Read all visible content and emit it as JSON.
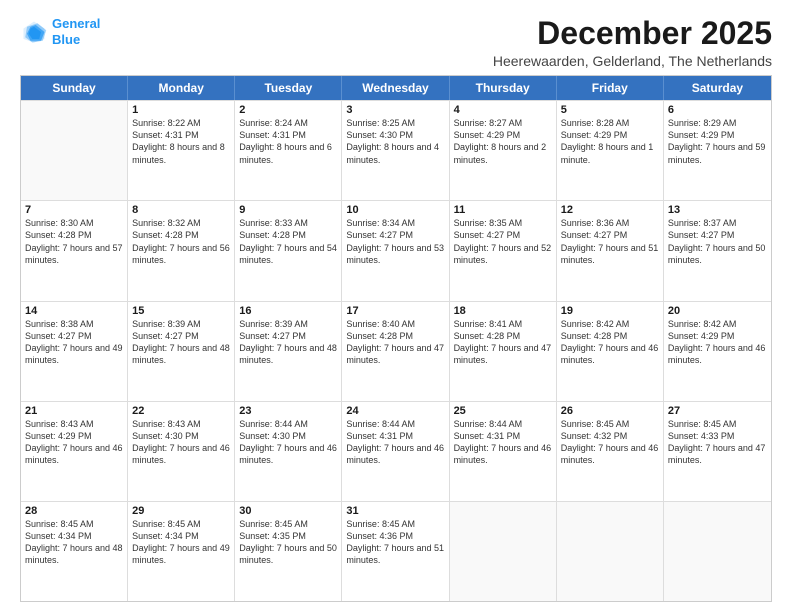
{
  "logo": {
    "line1": "General",
    "line2": "Blue"
  },
  "title": "December 2025",
  "location": "Heerewaarden, Gelderland, The Netherlands",
  "header_days": [
    "Sunday",
    "Monday",
    "Tuesday",
    "Wednesday",
    "Thursday",
    "Friday",
    "Saturday"
  ],
  "weeks": [
    [
      {
        "day": "",
        "sunrise": "",
        "sunset": "",
        "daylight": ""
      },
      {
        "day": "1",
        "sunrise": "Sunrise: 8:22 AM",
        "sunset": "Sunset: 4:31 PM",
        "daylight": "Daylight: 8 hours and 8 minutes."
      },
      {
        "day": "2",
        "sunrise": "Sunrise: 8:24 AM",
        "sunset": "Sunset: 4:31 PM",
        "daylight": "Daylight: 8 hours and 6 minutes."
      },
      {
        "day": "3",
        "sunrise": "Sunrise: 8:25 AM",
        "sunset": "Sunset: 4:30 PM",
        "daylight": "Daylight: 8 hours and 4 minutes."
      },
      {
        "day": "4",
        "sunrise": "Sunrise: 8:27 AM",
        "sunset": "Sunset: 4:29 PM",
        "daylight": "Daylight: 8 hours and 2 minutes."
      },
      {
        "day": "5",
        "sunrise": "Sunrise: 8:28 AM",
        "sunset": "Sunset: 4:29 PM",
        "daylight": "Daylight: 8 hours and 1 minute."
      },
      {
        "day": "6",
        "sunrise": "Sunrise: 8:29 AM",
        "sunset": "Sunset: 4:29 PM",
        "daylight": "Daylight: 7 hours and 59 minutes."
      }
    ],
    [
      {
        "day": "7",
        "sunrise": "Sunrise: 8:30 AM",
        "sunset": "Sunset: 4:28 PM",
        "daylight": "Daylight: 7 hours and 57 minutes."
      },
      {
        "day": "8",
        "sunrise": "Sunrise: 8:32 AM",
        "sunset": "Sunset: 4:28 PM",
        "daylight": "Daylight: 7 hours and 56 minutes."
      },
      {
        "day": "9",
        "sunrise": "Sunrise: 8:33 AM",
        "sunset": "Sunset: 4:28 PM",
        "daylight": "Daylight: 7 hours and 54 minutes."
      },
      {
        "day": "10",
        "sunrise": "Sunrise: 8:34 AM",
        "sunset": "Sunset: 4:27 PM",
        "daylight": "Daylight: 7 hours and 53 minutes."
      },
      {
        "day": "11",
        "sunrise": "Sunrise: 8:35 AM",
        "sunset": "Sunset: 4:27 PM",
        "daylight": "Daylight: 7 hours and 52 minutes."
      },
      {
        "day": "12",
        "sunrise": "Sunrise: 8:36 AM",
        "sunset": "Sunset: 4:27 PM",
        "daylight": "Daylight: 7 hours and 51 minutes."
      },
      {
        "day": "13",
        "sunrise": "Sunrise: 8:37 AM",
        "sunset": "Sunset: 4:27 PM",
        "daylight": "Daylight: 7 hours and 50 minutes."
      }
    ],
    [
      {
        "day": "14",
        "sunrise": "Sunrise: 8:38 AM",
        "sunset": "Sunset: 4:27 PM",
        "daylight": "Daylight: 7 hours and 49 minutes."
      },
      {
        "day": "15",
        "sunrise": "Sunrise: 8:39 AM",
        "sunset": "Sunset: 4:27 PM",
        "daylight": "Daylight: 7 hours and 48 minutes."
      },
      {
        "day": "16",
        "sunrise": "Sunrise: 8:39 AM",
        "sunset": "Sunset: 4:27 PM",
        "daylight": "Daylight: 7 hours and 48 minutes."
      },
      {
        "day": "17",
        "sunrise": "Sunrise: 8:40 AM",
        "sunset": "Sunset: 4:28 PM",
        "daylight": "Daylight: 7 hours and 47 minutes."
      },
      {
        "day": "18",
        "sunrise": "Sunrise: 8:41 AM",
        "sunset": "Sunset: 4:28 PM",
        "daylight": "Daylight: 7 hours and 47 minutes."
      },
      {
        "day": "19",
        "sunrise": "Sunrise: 8:42 AM",
        "sunset": "Sunset: 4:28 PM",
        "daylight": "Daylight: 7 hours and 46 minutes."
      },
      {
        "day": "20",
        "sunrise": "Sunrise: 8:42 AM",
        "sunset": "Sunset: 4:29 PM",
        "daylight": "Daylight: 7 hours and 46 minutes."
      }
    ],
    [
      {
        "day": "21",
        "sunrise": "Sunrise: 8:43 AM",
        "sunset": "Sunset: 4:29 PM",
        "daylight": "Daylight: 7 hours and 46 minutes."
      },
      {
        "day": "22",
        "sunrise": "Sunrise: 8:43 AM",
        "sunset": "Sunset: 4:30 PM",
        "daylight": "Daylight: 7 hours and 46 minutes."
      },
      {
        "day": "23",
        "sunrise": "Sunrise: 8:44 AM",
        "sunset": "Sunset: 4:30 PM",
        "daylight": "Daylight: 7 hours and 46 minutes."
      },
      {
        "day": "24",
        "sunrise": "Sunrise: 8:44 AM",
        "sunset": "Sunset: 4:31 PM",
        "daylight": "Daylight: 7 hours and 46 minutes."
      },
      {
        "day": "25",
        "sunrise": "Sunrise: 8:44 AM",
        "sunset": "Sunset: 4:31 PM",
        "daylight": "Daylight: 7 hours and 46 minutes."
      },
      {
        "day": "26",
        "sunrise": "Sunrise: 8:45 AM",
        "sunset": "Sunset: 4:32 PM",
        "daylight": "Daylight: 7 hours and 46 minutes."
      },
      {
        "day": "27",
        "sunrise": "Sunrise: 8:45 AM",
        "sunset": "Sunset: 4:33 PM",
        "daylight": "Daylight: 7 hours and 47 minutes."
      }
    ],
    [
      {
        "day": "28",
        "sunrise": "Sunrise: 8:45 AM",
        "sunset": "Sunset: 4:34 PM",
        "daylight": "Daylight: 7 hours and 48 minutes."
      },
      {
        "day": "29",
        "sunrise": "Sunrise: 8:45 AM",
        "sunset": "Sunset: 4:34 PM",
        "daylight": "Daylight: 7 hours and 49 minutes."
      },
      {
        "day": "30",
        "sunrise": "Sunrise: 8:45 AM",
        "sunset": "Sunset: 4:35 PM",
        "daylight": "Daylight: 7 hours and 50 minutes."
      },
      {
        "day": "31",
        "sunrise": "Sunrise: 8:45 AM",
        "sunset": "Sunset: 4:36 PM",
        "daylight": "Daylight: 7 hours and 51 minutes."
      },
      {
        "day": "",
        "sunrise": "",
        "sunset": "",
        "daylight": ""
      },
      {
        "day": "",
        "sunrise": "",
        "sunset": "",
        "daylight": ""
      },
      {
        "day": "",
        "sunrise": "",
        "sunset": "",
        "daylight": ""
      }
    ]
  ]
}
